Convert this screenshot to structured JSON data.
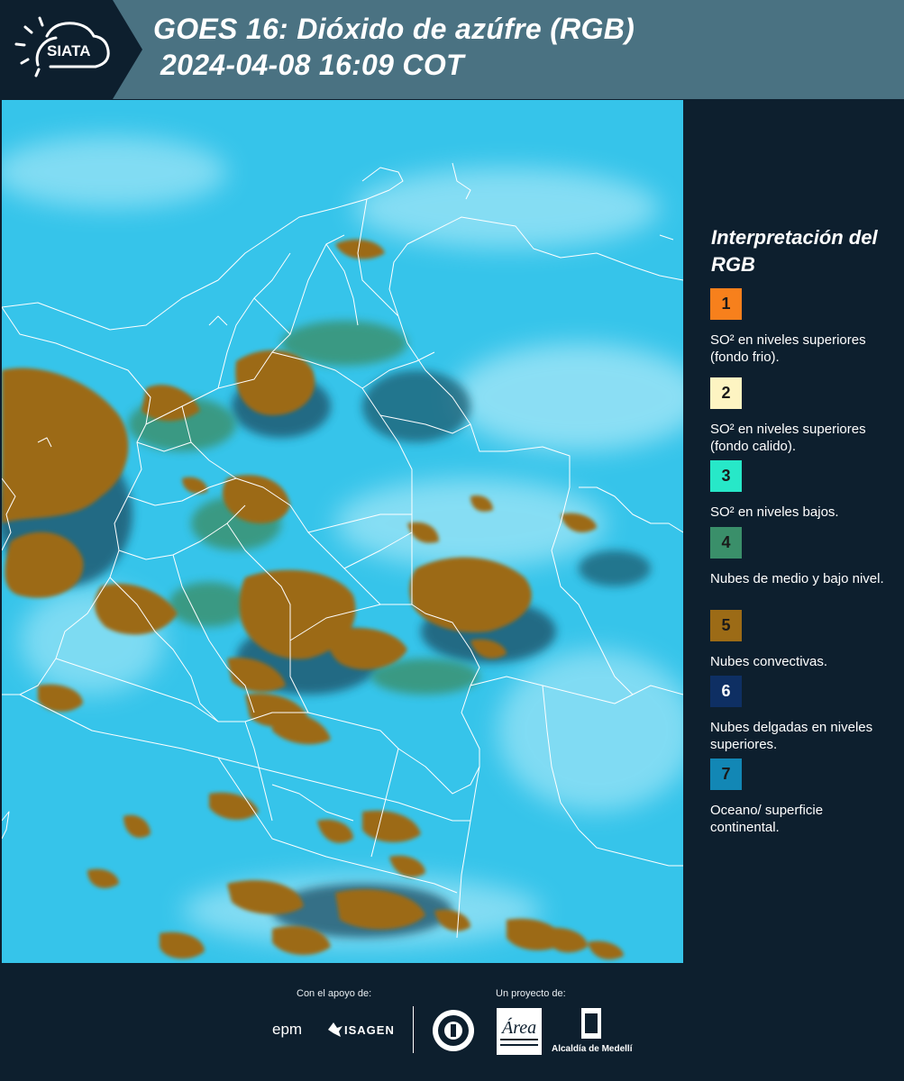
{
  "header": {
    "logo_text": "SIATA",
    "title_line1": "GOES 16: Dióxido de azúfre (RGB)",
    "title_line2": "2024-04-08 16:09 COT"
  },
  "legend": {
    "title": "Interpretación del RGB",
    "items": [
      {
        "number": "1",
        "color": "#f7801c",
        "text": "SO² en niveles superiores (fondo frio)."
      },
      {
        "number": "2",
        "color": "#fdf4c2",
        "text": "SO² en niveles superiores (fondo calido)."
      },
      {
        "number": "3",
        "color": "#27e8c8",
        "text": "SO² en niveles bajos."
      },
      {
        "number": "4",
        "color": "#3a8f6a",
        "text": "Nubes de medio y bajo nivel."
      },
      {
        "number": "5",
        "color": "#9c6b16",
        "text": "Nubes convectivas."
      },
      {
        "number": "6",
        "color": "#0e2f63",
        "text": "Nubes delgadas en niveles superiores."
      },
      {
        "number": "7",
        "color": "#1287b5",
        "text": "Oceano/ superficie continental."
      }
    ]
  },
  "footer": {
    "support_label": "Con el apoyo de:",
    "project_label": "Un proyecto de:",
    "sponsor_1": "epm",
    "sponsor_2": "ISAGEN",
    "partner_1": "Área Metropolitana Valle de Aburrá",
    "partner_2": "Alcaldía de Medellín"
  },
  "colors": {
    "header_bg": "#4a7282",
    "panel_bg": "#0d1f2e",
    "map_background": "#36c4ea",
    "cloud_convective": "#9c6b16",
    "cloud_mid": "#3a8f6a",
    "boundary": "#ffffff"
  }
}
